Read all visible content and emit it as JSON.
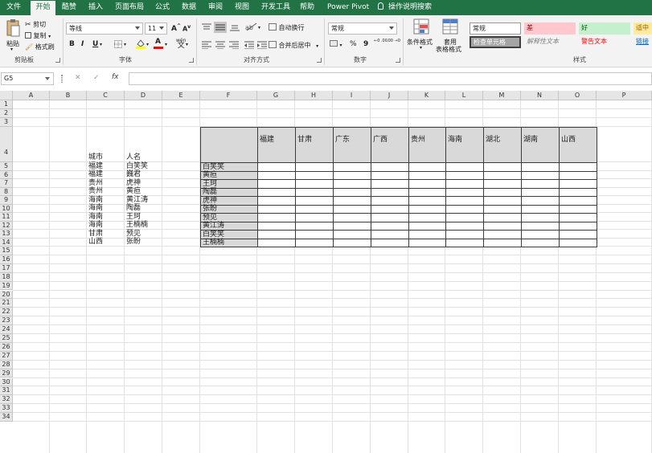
{
  "tabs": [
    {
      "label": "文件",
      "active": false
    },
    {
      "label": "开始",
      "active": true
    },
    {
      "label": "酷赞",
      "active": false
    },
    {
      "label": "插入",
      "active": false
    },
    {
      "label": "页面布局",
      "active": false
    },
    {
      "label": "公式",
      "active": false
    },
    {
      "label": "数据",
      "active": false
    },
    {
      "label": "审阅",
      "active": false
    },
    {
      "label": "视图",
      "active": false
    },
    {
      "label": "开发工具",
      "active": false
    },
    {
      "label": "帮助",
      "active": false
    },
    {
      "label": "Power Pivot",
      "active": false
    }
  ],
  "tell_me": "操作说明搜索",
  "clipboard": {
    "paste": "粘贴",
    "cut": "剪切",
    "copy": "复制",
    "format_painter": "格式刷",
    "group": "剪贴板"
  },
  "font": {
    "name": "等线",
    "size": "11",
    "grow": "A",
    "shrink": "A",
    "bold": "B",
    "italic": "I",
    "underline": "U",
    "color_letter": "A",
    "wen": "wén",
    "group": "字体"
  },
  "alignment": {
    "wrap": "自动换行",
    "merge": "合并后居中",
    "group": "对齐方式"
  },
  "number": {
    "format": "常规",
    "percent": "%",
    "comma": "9",
    "inc": "←0 .00",
    "dec": ".00 →0",
    "group": "数字"
  },
  "styles": {
    "conditional": "条件格式",
    "table_line1": "套用",
    "table_line2": "表格格式",
    "cells": [
      {
        "label": "常规",
        "bg": "#ffffff",
        "fg": "#222222"
      },
      {
        "label": "差",
        "bg": "#ffc7ce",
        "fg": "#9c0006"
      },
      {
        "label": "好",
        "bg": "#c6efce",
        "fg": "#006100"
      },
      {
        "label": "适中",
        "bg": "#ffeb9c",
        "fg": "#9c5700"
      },
      {
        "label": "检查单元格",
        "bg": "#a5a5a5",
        "fg": "#ffffff"
      },
      {
        "label": "解释性文本",
        "bg": "#f3f3f3",
        "fg": "#7f7f7f"
      },
      {
        "label": "警告文本",
        "bg": "#f3f3f3",
        "fg": "#ff0000"
      },
      {
        "label": "链接",
        "bg": "#f3f3f3",
        "fg": "#0563c1"
      }
    ],
    "group": "样式"
  },
  "formula_bar": {
    "name_box": "G5",
    "cancel": "✕",
    "enter": "✓",
    "fx": "fx",
    "formula": ""
  },
  "columns": [
    "A",
    "B",
    "C",
    "D",
    "E",
    "F",
    "G",
    "H",
    "I",
    "J",
    "K",
    "L",
    "M",
    "N",
    "O",
    "P"
  ],
  "rows": [
    "1",
    "2",
    "3",
    "4",
    "5",
    "6",
    "7",
    "8",
    "9",
    "10",
    "11",
    "12",
    "13",
    "14",
    "15",
    "16",
    "17",
    "18",
    "19",
    "20",
    "21",
    "22",
    "23",
    "24",
    "25",
    "26",
    "27",
    "28",
    "29",
    "30",
    "31",
    "32",
    "33",
    "34"
  ],
  "source_table": {
    "headers": [
      "城市",
      "人名"
    ],
    "rows": [
      [
        "福建",
        "白笑笑"
      ],
      [
        "福建",
        "巍君"
      ],
      [
        "贵州",
        "虎神"
      ],
      [
        "贵州",
        "黄疸"
      ],
      [
        "海南",
        "黄江涛"
      ],
      [
        "海南",
        "陶磊"
      ],
      [
        "海南",
        "王珂"
      ],
      [
        "海南",
        "王楠楠"
      ],
      [
        "甘肃",
        "预见"
      ],
      [
        "山西",
        "张盼"
      ]
    ]
  },
  "matrix": {
    "col_headers": [
      "福建",
      "甘肃",
      "广东",
      "广西",
      "贵州",
      "海南",
      "湖北",
      "湖南",
      "山西"
    ],
    "row_headers": [
      "白笑笑",
      "黄疸",
      "王珂",
      "陶磊",
      "虎神",
      "张盼",
      "预见",
      "黄江涛",
      "白笑笑",
      "王楠楠"
    ]
  },
  "colors": {
    "ribbon_green": "#217346",
    "header_grey": "#d9d9d9"
  }
}
